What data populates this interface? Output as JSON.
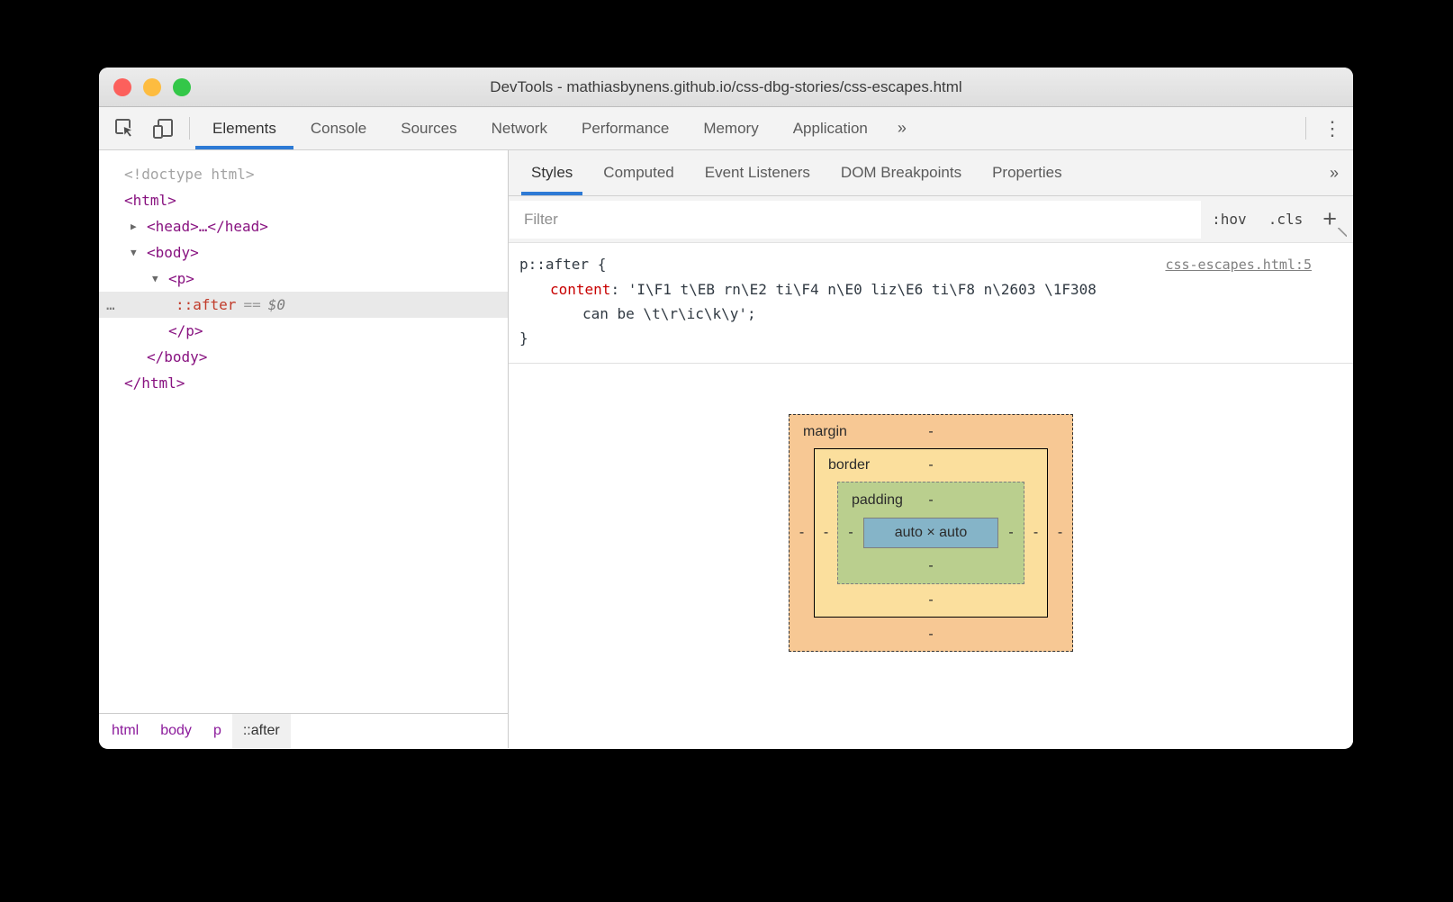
{
  "window": {
    "title": "DevTools - mathiasbynens.github.io/css-dbg-stories/css-escapes.html"
  },
  "traffic_lights": {
    "close": "#fc605c",
    "minimize": "#fdbc40",
    "zoom": "#33c748"
  },
  "main_tabs": {
    "items": [
      "Elements",
      "Console",
      "Sources",
      "Network",
      "Performance",
      "Memory",
      "Application"
    ],
    "selected": "Elements",
    "overflow": "»",
    "menu_icon": "⋮"
  },
  "dom_tree": {
    "lines": [
      {
        "arrow": "",
        "text": "<!doctype html>"
      },
      {
        "arrow": "",
        "text": "<html>"
      },
      {
        "arrow": "▶",
        "text": "<head>…</head>"
      },
      {
        "arrow": "▼",
        "text": "<body>"
      },
      {
        "arrow": "▼",
        "text": "<p>"
      },
      {
        "gutter": "…",
        "pseudo": "::after",
        "equals": "==",
        "dollar": "$0"
      },
      {
        "arrow": "",
        "text": "</p>"
      },
      {
        "arrow": "",
        "text": "</body>"
      },
      {
        "arrow": "",
        "text": "</html>"
      }
    ]
  },
  "breadcrumbs": {
    "items": [
      "html",
      "body",
      "p",
      "::after"
    ],
    "selected": "::after"
  },
  "styles_tabs": {
    "items": [
      "Styles",
      "Computed",
      "Event Listeners",
      "DOM Breakpoints",
      "Properties"
    ],
    "selected": "Styles",
    "overflow": "»"
  },
  "filter_bar": {
    "placeholder": "Filter",
    "pseudo_toggle": ":hov",
    "class_toggle": ".cls",
    "new_rule": "+"
  },
  "rule": {
    "selector": "p::after",
    "open_brace": "{",
    "source_link": "css-escapes.html:5",
    "property": "content",
    "colon": ": ",
    "value_line1": "'I\\F1 t\\EB rn\\E2 ti\\F4 n\\E0 liz\\E6 ti\\F8 n\\2603 \\1F308",
    "value_line2": "can be \\t\\r\\ic\\k\\y';",
    "close_brace": "}"
  },
  "box_model": {
    "margin": {
      "label": "margin",
      "top": "-",
      "right": "-",
      "bottom": "-",
      "left": "-",
      "color": "#f7c894"
    },
    "border": {
      "label": "border",
      "top": "-",
      "right": "-",
      "bottom": "-",
      "left": "-",
      "color": "#fbdf9d"
    },
    "padding": {
      "label": "padding",
      "top": "-",
      "right": "-",
      "bottom": "-",
      "left": "-",
      "color": "#bacf8e"
    },
    "content": {
      "text": "auto × auto",
      "color": "#85b4c8"
    }
  }
}
